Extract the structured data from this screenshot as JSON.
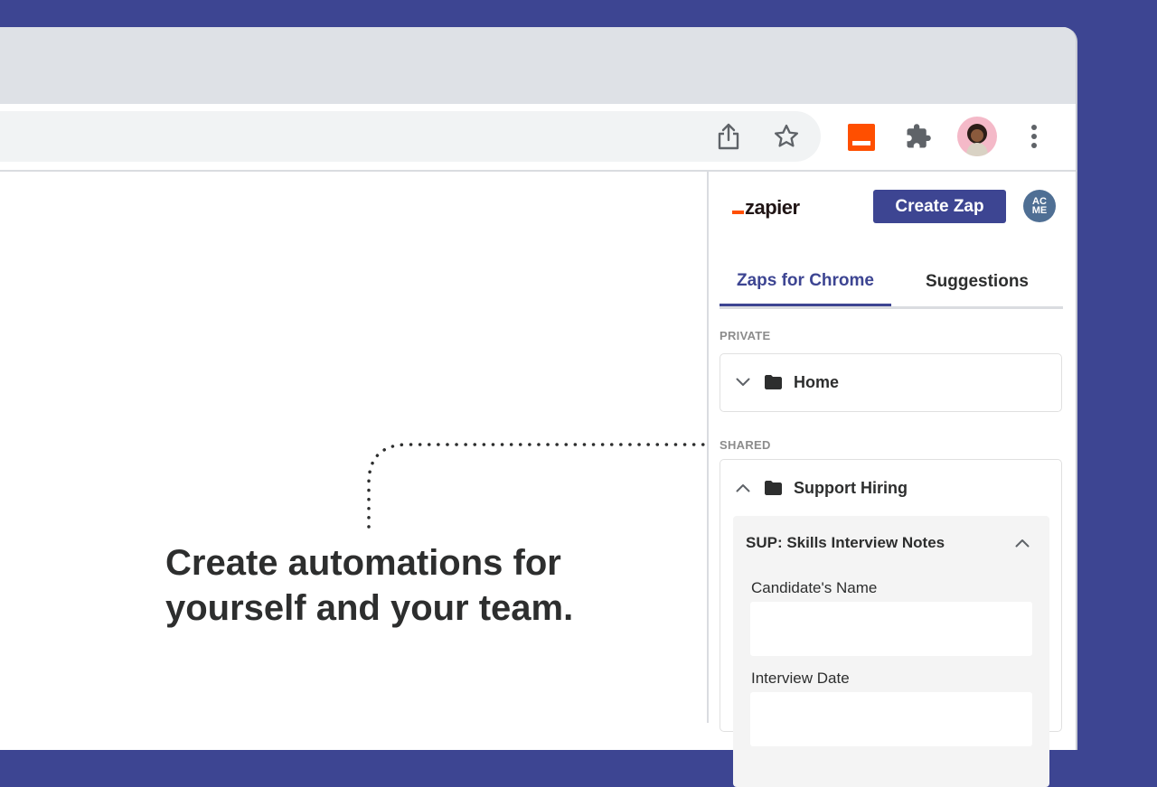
{
  "colors": {
    "background": "#3d4592",
    "accent": "#3d4592",
    "zapier_orange": "#ff4f00",
    "avatar_bg": "#4f6f94"
  },
  "browser": {
    "toolbar": {
      "icons": [
        "share-icon",
        "star-icon",
        "zapier-extension-icon",
        "puzzle-icon",
        "avatar",
        "more-vert-icon"
      ]
    }
  },
  "page": {
    "headline_line1": "Create automations for",
    "headline_line2": "yourself and your team."
  },
  "panel": {
    "logo_text": "zapier",
    "create_button": "Create Zap",
    "account_initials_top": "AC",
    "account_initials_bottom": "ME",
    "tabs": [
      {
        "label": "Zaps for Chrome",
        "active": true
      },
      {
        "label": "Suggestions",
        "active": false
      }
    ],
    "private": {
      "label": "PRIVATE",
      "folders": [
        {
          "name": "Home",
          "expanded": false
        }
      ]
    },
    "shared": {
      "label": "SHARED",
      "folders": [
        {
          "name": "Support Hiring",
          "expanded": true
        }
      ]
    },
    "zap": {
      "title": "SUP: Skills Interview Notes",
      "fields": [
        {
          "label": "Candidate's Name",
          "value": ""
        },
        {
          "label": "Interview Date",
          "value": ""
        }
      ]
    }
  }
}
